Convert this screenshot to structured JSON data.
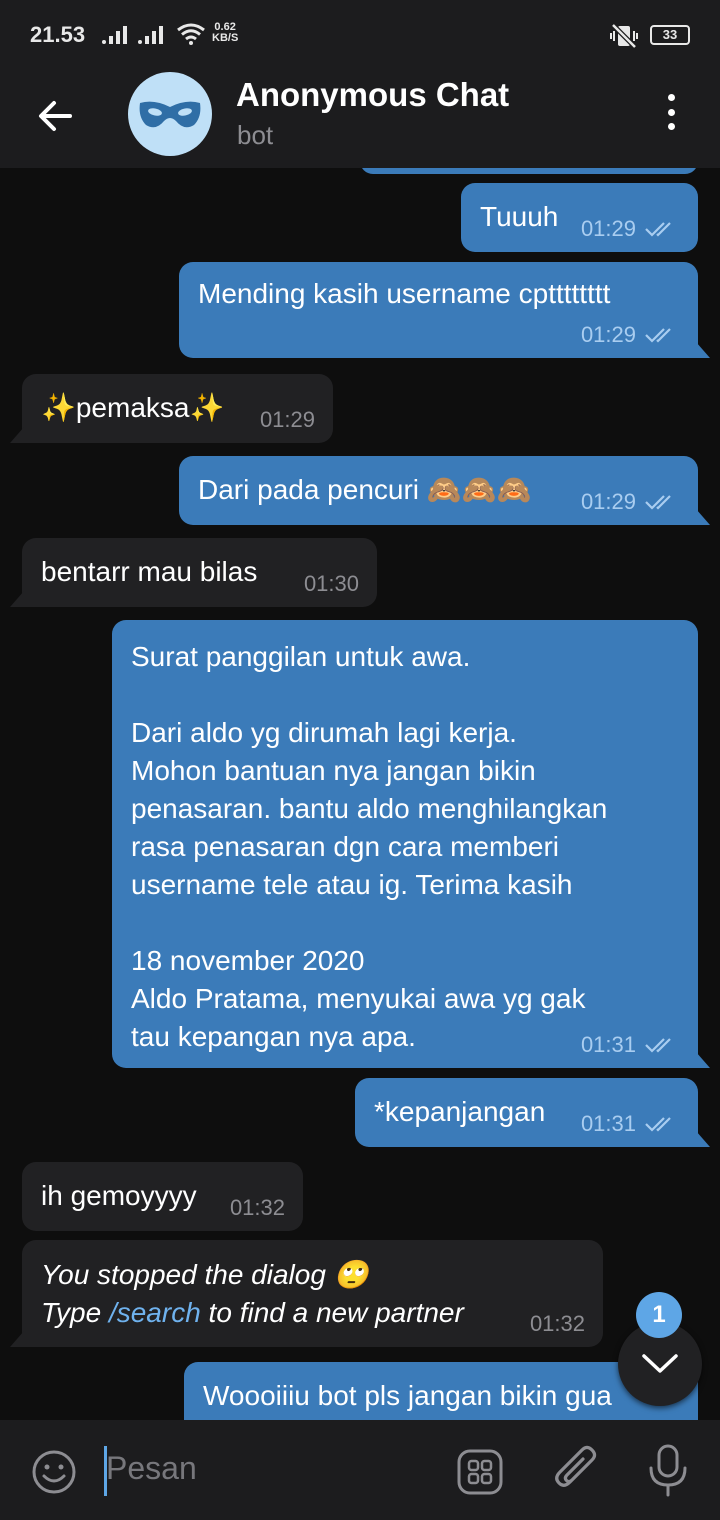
{
  "status_bar": {
    "time": "21.53",
    "net_speed_value": "0.62",
    "net_speed_unit": "KB/S",
    "battery": "33"
  },
  "header": {
    "title": "Anonymous Chat",
    "subtitle": "bot",
    "avatar_icon": "mask-icon",
    "accent": "#bfe0f7"
  },
  "messages": [
    {
      "dir": "out",
      "text": "Tuuuh",
      "time": "01:29"
    },
    {
      "dir": "out",
      "text": "Mending kasih username cptttttttt",
      "time": "01:29"
    },
    {
      "dir": "in",
      "text": "✨pemaksa✨",
      "time": "01:29"
    },
    {
      "dir": "out",
      "text": "Dari pada pencuri 🙈🙈🙈",
      "time": "01:29"
    },
    {
      "dir": "in",
      "text": "bentarr mau bilas",
      "time": "01:30"
    },
    {
      "dir": "out",
      "text": "Surat panggilan untuk awa.\n\nDari aldo yg dirumah lagi kerja.\nMohon bantuan nya jangan bikin\npenasaran. bantu aldo menghilangkan\nrasa penasaran dgn cara memberi\nusername tele atau ig. Terima kasih\n\n18 november 2020\nAldo Pratama, menyukai awa yg gak\ntau kepangan nya apa.",
      "time": "01:31"
    },
    {
      "dir": "out",
      "text": "*kepanjangan",
      "time": "01:31"
    },
    {
      "dir": "in",
      "text": "ih gemoyyyy",
      "time": "01:32"
    },
    {
      "dir": "in",
      "line1": "You stopped the dialog 🙄",
      "line2_pre": "Type ",
      "line2_link": "/search",
      "line2_post": " to find a new partner",
      "time": "01:32"
    },
    {
      "dir": "out",
      "text": "Woooiiiu bot pls jangan bikin gua"
    }
  ],
  "scroll_button": {
    "unread_count": "1"
  },
  "composer": {
    "placeholder": "Pesan"
  },
  "colors": {
    "outgoing_bubble": "#3b7bb9",
    "incoming_bubble": "#212123",
    "background": "#0e0e0e",
    "bar": "#1c1c1e",
    "link": "#6fb2ee"
  }
}
